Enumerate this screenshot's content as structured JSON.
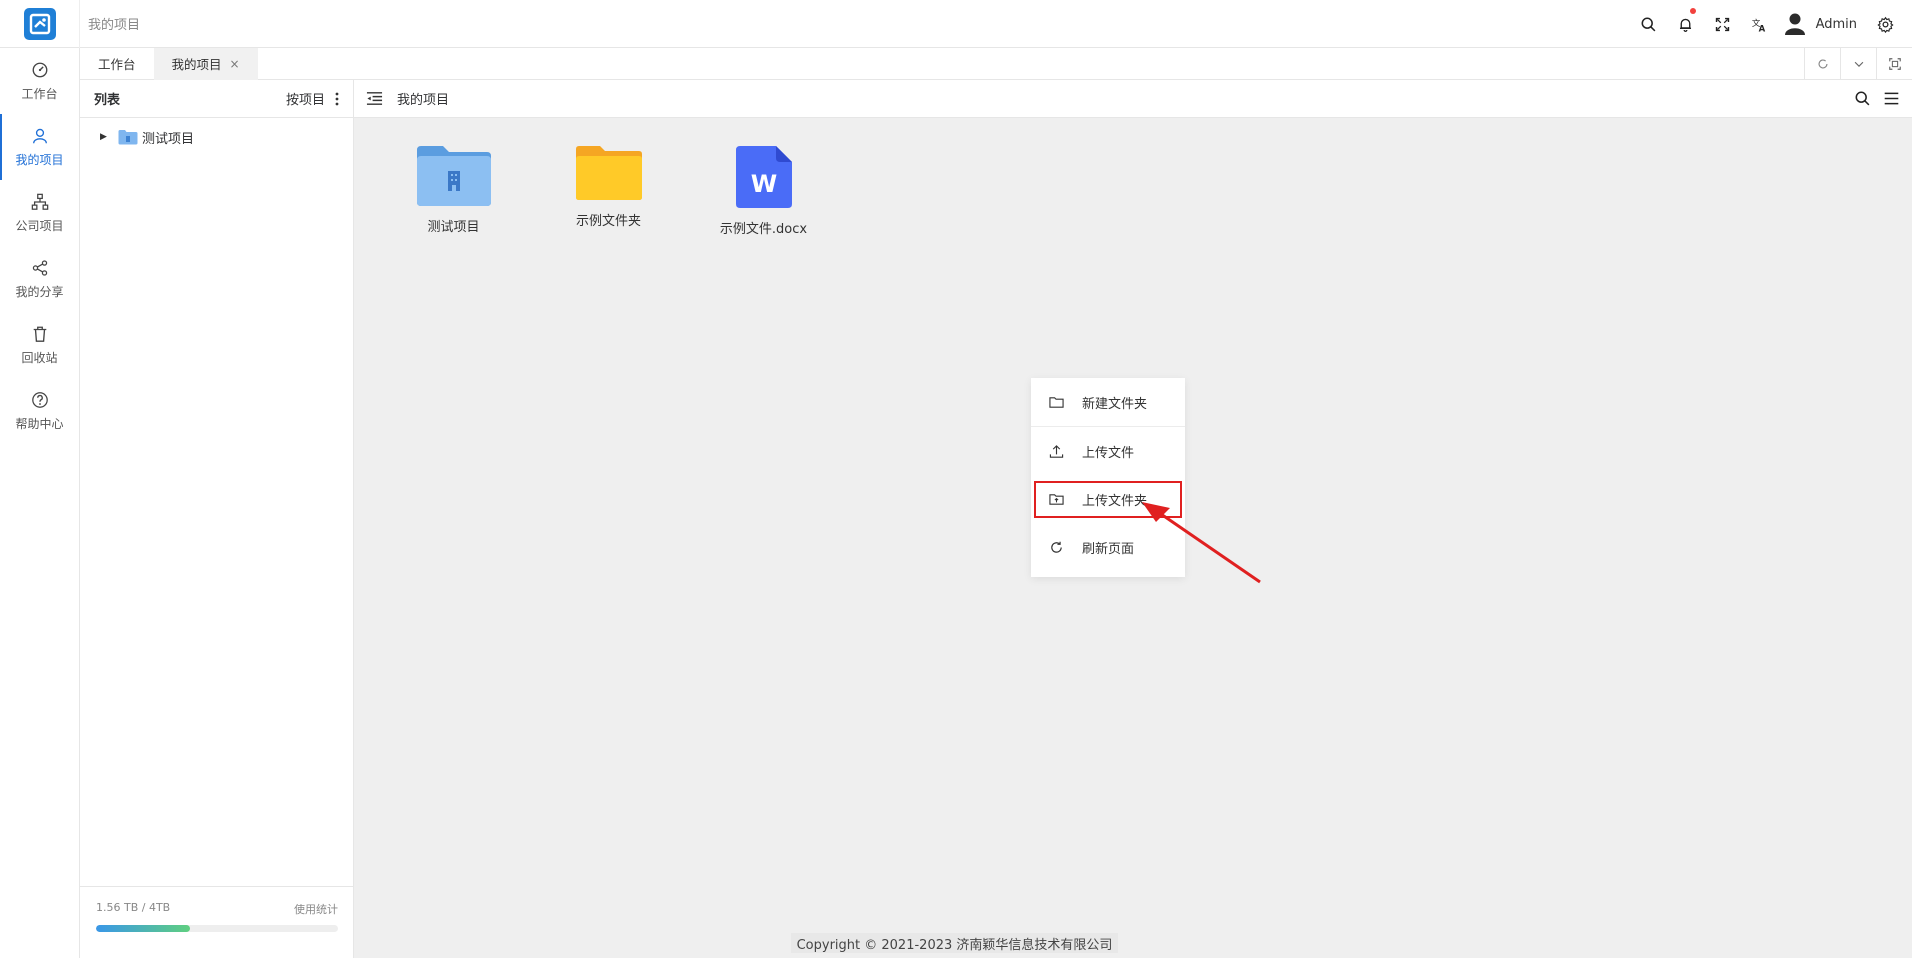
{
  "header": {
    "breadcrumb": "我的项目",
    "user_name": "Admin",
    "notification_badge_color": "#f2413d"
  },
  "rail": {
    "items": [
      {
        "label": "工作台",
        "icon": "dashboard-icon"
      },
      {
        "label": "我的项目",
        "icon": "user-icon",
        "active": true
      },
      {
        "label": "公司项目",
        "icon": "org-chart-icon"
      },
      {
        "label": "我的分享",
        "icon": "share-icon"
      },
      {
        "label": "回收站",
        "icon": "trash-icon"
      },
      {
        "label": "帮助中心",
        "icon": "help-icon"
      }
    ]
  },
  "tabs": [
    {
      "label": "工作台"
    },
    {
      "label": "我的项目",
      "active": true,
      "close": "×"
    }
  ],
  "tree": {
    "title": "列表",
    "sort_label": "按项目",
    "nodes": [
      {
        "label": "测试项目"
      }
    ],
    "usage": "1.56 TB / 4TB",
    "usage_link": "使用统计",
    "usage_fraction": 0.39
  },
  "main": {
    "title": "我的项目",
    "files": [
      {
        "name": "测试项目",
        "type": "project-folder"
      },
      {
        "name": "示例文件夹",
        "type": "folder"
      },
      {
        "name": "示例文件.docx",
        "type": "word-doc"
      }
    ]
  },
  "context_menu": {
    "items": [
      {
        "label": "新建文件夹",
        "icon": "folder-icon"
      },
      {
        "label": "上传文件",
        "icon": "upload-icon"
      },
      {
        "label": "上传文件夹",
        "icon": "upload-folder-icon",
        "highlighted": true
      },
      {
        "label": "刷新页面",
        "icon": "refresh-icon"
      }
    ]
  },
  "copyright": "Copyright © 2021-2023 济南颖华信息技术有限公司",
  "colors": {
    "accent": "#1f6fd6",
    "highlight": "#e02020"
  }
}
